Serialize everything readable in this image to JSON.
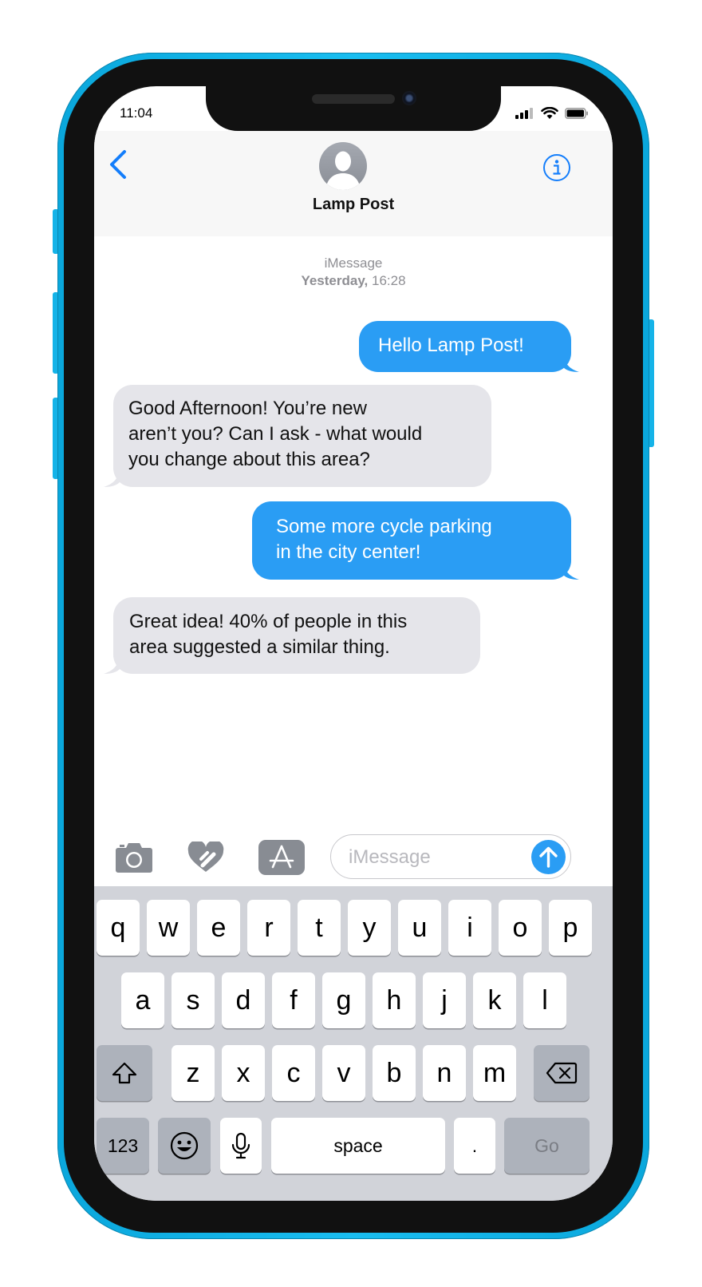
{
  "status": {
    "time": "11:04"
  },
  "header": {
    "contact_name": "Lamp Post"
  },
  "thread": {
    "service": "iMessage",
    "date_day": "Yesterday,",
    "date_time": "16:28"
  },
  "messages": [
    {
      "direction": "out",
      "lines": [
        "Hello Lamp Post!"
      ]
    },
    {
      "direction": "in",
      "lines": [
        "Good Afternoon! You’re new",
        "aren’t you? Can I ask - what would",
        "you change about this area?"
      ]
    },
    {
      "direction": "out",
      "lines": [
        "Some more cycle parking",
        "in the city center!"
      ]
    },
    {
      "direction": "in",
      "lines": [
        "Great idea! 40% of people in this",
        "area suggested a similar thing."
      ]
    }
  ],
  "composer": {
    "placeholder": "iMessage"
  },
  "keyboard": {
    "row1": [
      "q",
      "w",
      "e",
      "r",
      "t",
      "y",
      "u",
      "i",
      "o",
      "p"
    ],
    "row2": [
      "a",
      "s",
      "d",
      "f",
      "g",
      "h",
      "j",
      "k",
      "l"
    ],
    "row3": [
      "z",
      "x",
      "c",
      "v",
      "b",
      "n",
      "m"
    ],
    "numbers_label": "123",
    "space_label": "space",
    "period_label": ".",
    "go_label": "Go"
  },
  "colors": {
    "frame": "#19bdf0",
    "outgoing_bubble": "#2a9df4",
    "incoming_bubble": "#e5e5ea",
    "ios_blue": "#147efb"
  }
}
